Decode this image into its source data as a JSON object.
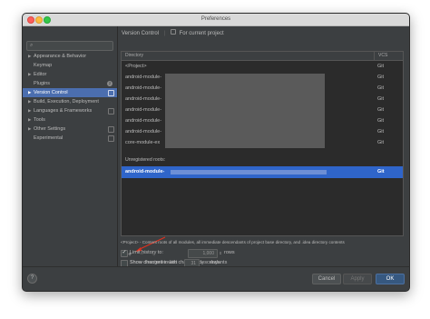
{
  "window": {
    "title": "Preferences"
  },
  "sidebar": {
    "items": [
      {
        "label": "Appearance & Behavior",
        "arrow": "▶"
      },
      {
        "label": "Keymap",
        "arrow": ""
      },
      {
        "label": "Editor",
        "arrow": "▶"
      },
      {
        "label": "Plugins",
        "arrow": "",
        "badge": "2"
      },
      {
        "label": "Version Control",
        "arrow": "▶",
        "selected": true
      },
      {
        "label": "Build, Execution, Deployment",
        "arrow": "▶"
      },
      {
        "label": "Languages & Frameworks",
        "arrow": "▶"
      },
      {
        "label": "Tools",
        "arrow": "▶"
      },
      {
        "label": "Other Settings",
        "arrow": "▶"
      },
      {
        "label": "Experimental",
        "arrow": ""
      }
    ]
  },
  "main": {
    "header": {
      "title": "Version Control",
      "scope": "For current project"
    },
    "table": {
      "columns": [
        "Directory",
        "VCS"
      ],
      "rows": [
        {
          "directory": "<Project>",
          "vcs": "Git"
        },
        {
          "directory": "android-module-",
          "vcs": "Git"
        },
        {
          "directory": "android-module-",
          "vcs": "Git"
        },
        {
          "directory": "android-module-",
          "vcs": "Git"
        },
        {
          "directory": "android-module-",
          "vcs": "Git"
        },
        {
          "directory": "android-module-",
          "vcs": "Git"
        },
        {
          "directory": "android-module-",
          "vcs": "Git"
        },
        {
          "directory": "core-module-ex",
          "vcs": "Git"
        }
      ],
      "unregistered_label": "Unregistered roots:",
      "unregistered_row": {
        "directory": "android-module-",
        "vcs": "Git"
      }
    },
    "toolbar": {
      "add": "+",
      "remove": "−",
      "edit": "✎"
    },
    "note": "<Project> - Content roots of all modules, all immediate descendants of project base directory, and .idea directory contents",
    "options": {
      "limit_history": {
        "label": "Limit history to:",
        "value": "1,000",
        "suffix": "rows",
        "checked": true
      },
      "show_dirs": {
        "label": "Show directories with changed descendants",
        "checked": false
      },
      "show_changed": {
        "label": "Show changed in last",
        "value": "31",
        "suffix": "days",
        "checked": false
      }
    }
  },
  "footer": {
    "help": "?",
    "cancel": "Cancel",
    "apply": "Apply",
    "ok": "OK"
  },
  "colors": {
    "accent": "#2f65ca",
    "annotation_arrow": "#e0301e"
  }
}
